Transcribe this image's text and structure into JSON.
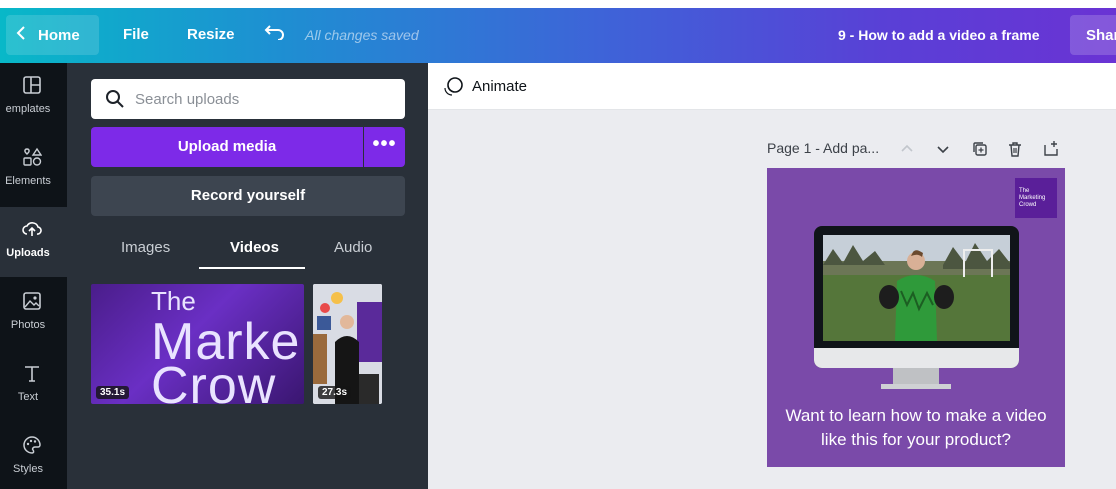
{
  "topbar": {
    "home_label": "Home",
    "file_label": "File",
    "resize_label": "Resize",
    "undo_icon": "undo-icon",
    "save_status": "All changes saved",
    "document_title": "9 - How to add a video a frame",
    "share_label": "Shar"
  },
  "rail": {
    "items": [
      {
        "label": "emplates",
        "icon": "templates-icon"
      },
      {
        "label": "Elements",
        "icon": "elements-icon"
      },
      {
        "label": "Uploads",
        "icon": "upload-cloud-icon"
      },
      {
        "label": "Photos",
        "icon": "photos-icon"
      },
      {
        "label": "Text",
        "icon": "text-icon"
      },
      {
        "label": "Styles",
        "icon": "palette-icon"
      }
    ]
  },
  "uploads": {
    "search_placeholder": "Search uploads",
    "upload_label": "Upload media",
    "more_label": "•••",
    "record_label": "Record yourself",
    "tabs": [
      {
        "label": "Images"
      },
      {
        "label": "Videos"
      },
      {
        "label": "Audio"
      }
    ],
    "videos": [
      {
        "duration": "35.1s",
        "line1": "The",
        "line2": "Marke",
        "line3": "Crow"
      },
      {
        "duration": "27.3s"
      }
    ]
  },
  "toolbar": {
    "animate_label": "Animate"
  },
  "page": {
    "header": "Page 1 - Add pa...",
    "logo_text": "The\nMarketing\nCrowd",
    "caption_line1": "Want to learn how to make a video",
    "caption_line2": "like this for your product?"
  },
  "colors": {
    "accent": "#7d2ae8",
    "panel": "#293039",
    "rail": "#0e1318",
    "canvas": "#ebecf0",
    "page_bg": "#7a4aa9"
  }
}
